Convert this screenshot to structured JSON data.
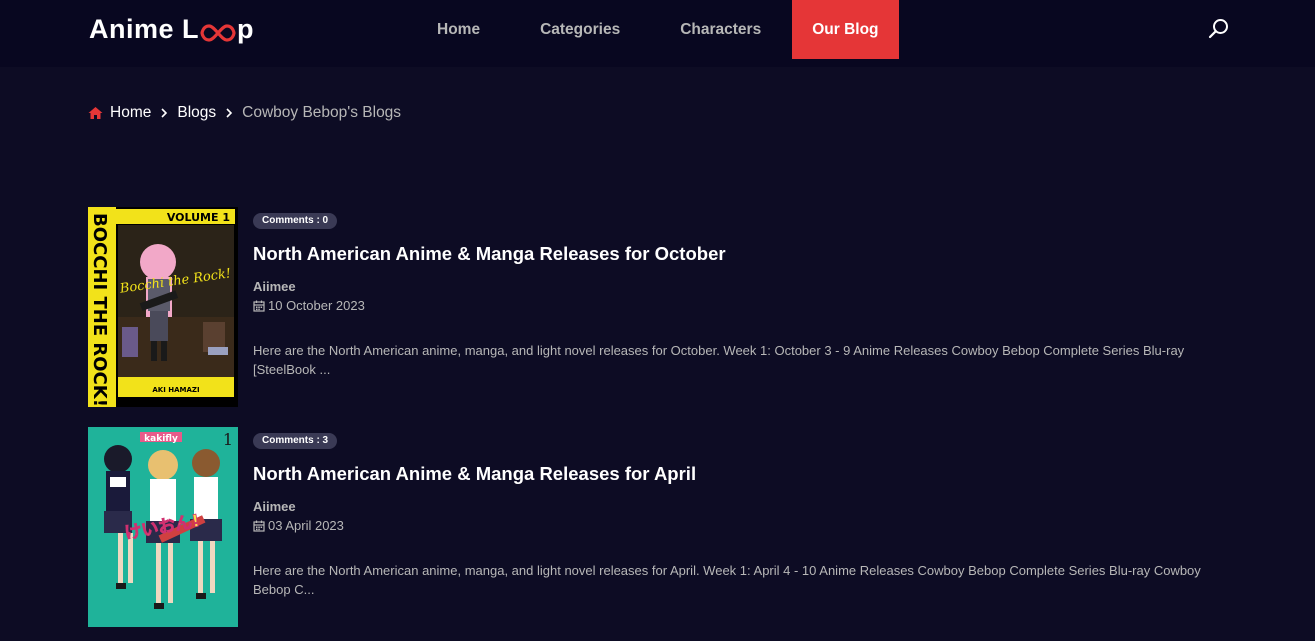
{
  "header": {
    "logo_text_start": "Anime L",
    "logo_text_end": "p",
    "nav": [
      {
        "label": "Home"
      },
      {
        "label": "Categories"
      },
      {
        "label": "Characters"
      },
      {
        "label": "Our Blog",
        "active": true
      }
    ],
    "search_icon": "search-icon"
  },
  "breadcrumb": {
    "home": "Home",
    "blogs": "Blogs",
    "current": "Cowboy Bebop's Blogs"
  },
  "posts": [
    {
      "comments": "Comments : 0",
      "title": "North American Anime & Manga Releases for October",
      "author": "Aiimee",
      "date": "10 October 2023",
      "excerpt": "Here are the North American anime, manga, and light novel releases for October. Week 1: October 3 - 9 Anime Releases Cowboy Bebop Complete Series Blu-ray [SteelBook ...",
      "cover": {
        "volume": "VOLUME 1",
        "spine": "BOCCHI THE ROCK!",
        "script": "Bocchi the Rock!",
        "author": "AKI HAMAZI"
      }
    },
    {
      "comments": "Comments : 3",
      "title": "North American Anime & Manga Releases for April",
      "author": "Aiimee",
      "date": "03 April 2023",
      "excerpt": "Here are the North American anime, manga, and light novel releases for April. Week 1: April 4 - 10 Anime Releases Cowboy Bebop Complete Series Blu-ray Cowboy Bebop C...",
      "cover": {
        "author": "kakifly",
        "number": "1",
        "script": "けいおん!"
      }
    }
  ],
  "colors": {
    "background": "#0d0c24",
    "header": "#080720",
    "accent": "#e53637",
    "muted_text": "#b7b7b7"
  }
}
